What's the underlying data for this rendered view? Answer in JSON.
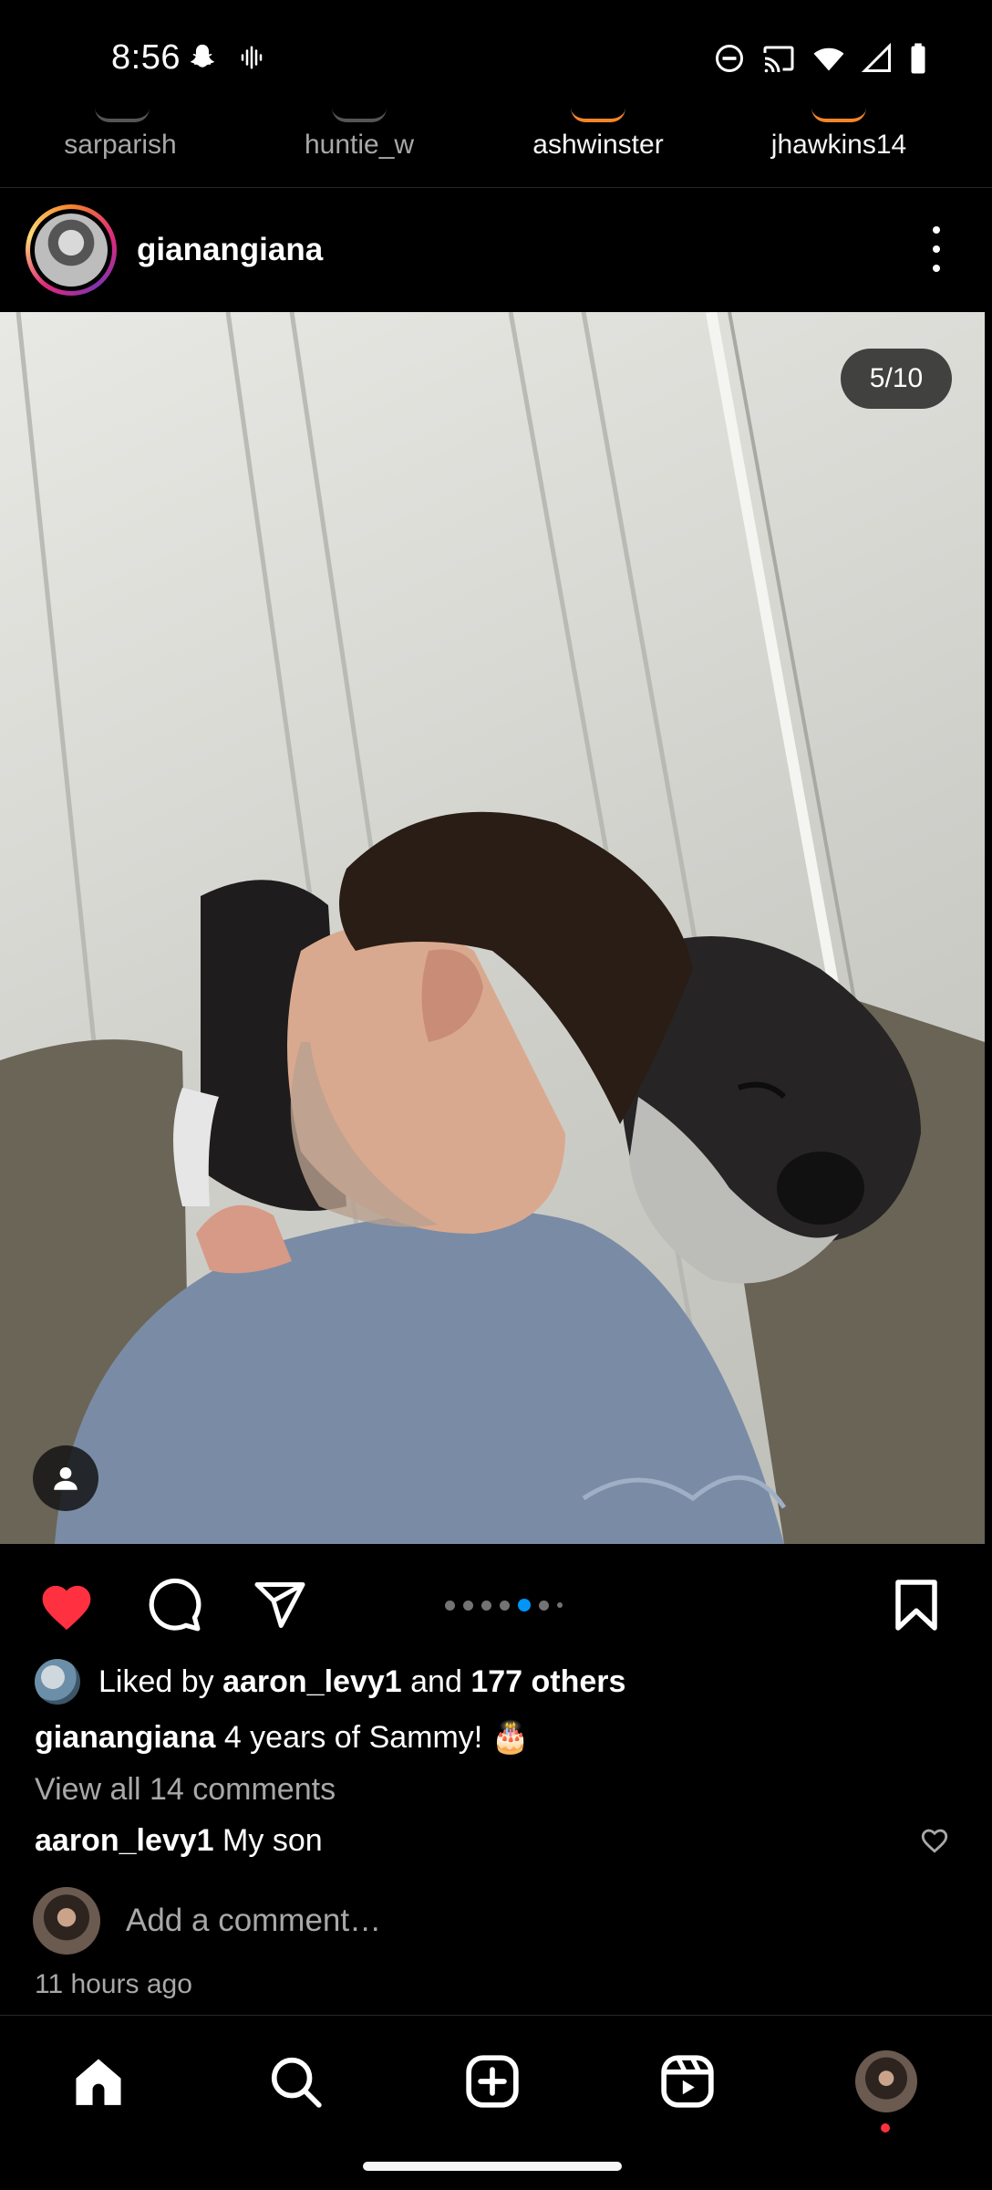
{
  "status_bar": {
    "time": "8:56",
    "left_icons": [
      "snapchat-icon",
      "voice-wave-icon"
    ],
    "right_icons": [
      "dnd-icon",
      "cast-icon",
      "wifi-icon",
      "signal-icon",
      "battery-icon"
    ]
  },
  "stories": [
    {
      "username": "sarparish",
      "seen": true
    },
    {
      "username": "huntie_w",
      "seen": true
    },
    {
      "username": "ashwinster",
      "seen": false
    },
    {
      "username": "jhawkins14",
      "seen": false
    }
  ],
  "post": {
    "username": "gianangiana",
    "carousel_counter": "5/10",
    "carousel_total": 10,
    "carousel_current": 5,
    "liked": true,
    "likes": {
      "prefix": "Liked by",
      "first_user": "aaron_levy1",
      "joiner": "and",
      "others": "177 others"
    },
    "caption": {
      "username": "gianangiana",
      "text": "4 years of Sammy! 🎂"
    },
    "view_comments": "View all 14 comments",
    "top_comment": {
      "username": "aaron_levy1",
      "text": "My son"
    },
    "add_comment_placeholder": "Add a comment…",
    "timestamp": "11 hours ago"
  },
  "colors": {
    "like_red": "#ff3040",
    "accent_blue": "#0095f6",
    "muted_text": "#a8a8a8",
    "background": "#000000"
  },
  "bottom_nav": [
    "home-icon",
    "search-icon",
    "create-icon",
    "reels-icon",
    "profile-avatar"
  ]
}
